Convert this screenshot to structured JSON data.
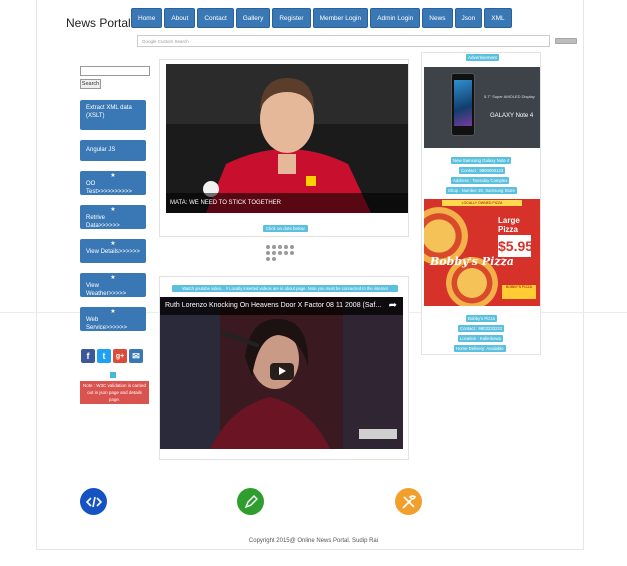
{
  "site": {
    "logo": "News Portal"
  },
  "nav": [
    "Home",
    "About",
    "Contact",
    "Gallery",
    "Register",
    "Member Login",
    "Admin Login",
    "News",
    "Json",
    "XML"
  ],
  "google_search": {
    "placeholder": "Google Custom Search"
  },
  "left": {
    "search_button": "Search",
    "buttons": [
      {
        "label": "Extract XML data (XSLT)",
        "star": false
      },
      {
        "label": "Angular JS",
        "star": false
      },
      {
        "label": "OO Test>>>>>>>>>>",
        "star": true
      },
      {
        "label": "Retrive Data>>>>>>",
        "star": true
      },
      {
        "label": "View Details>>>>>>",
        "star": true
      },
      {
        "label": "View Weather>>>>>",
        "star": true
      },
      {
        "label": "Web Service>>>>>>",
        "star": true
      }
    ],
    "note": "Note : W3C validation is carried out in json page and details page."
  },
  "carousel": {
    "caption": "MATA: WE NEED TO STICK TOGETHER",
    "click_label": "Click on dots below",
    "dot_count": 12
  },
  "video": {
    "label": "Watch youtube video... !! Locally inserted videos are in about page. Note you must be connected to the internet",
    "title": "Ruth Lorenzo Knocking On Heavens Door X Factor 08 11 2008 (Saf..."
  },
  "ads": {
    "advertisement_label": "Advertisement",
    "phone": {
      "text": "5.7\" Super AMOLED Display",
      "brand": "GALAXY Note 4"
    },
    "phone_details": [
      "New Samsung Galaxy Note 4",
      "Contact : 9800000123",
      "Address : Tansalay Complex",
      "Shop : Number 20, Samsung Store"
    ],
    "pizza": {
      "top_banner": "LOCALLY OWNED PIZZA",
      "title": "Large Pizza",
      "price": "$5.95",
      "brand": "Bobby's Pizza",
      "bottom": "BOBBY'S PIZZA"
    },
    "pizza_details": [
      "Bobby's Pizza",
      "Contact : 9803233222",
      "Location : Kalimbowa",
      "Home Delivery: Available"
    ]
  },
  "feature_icons": [
    "code-icon",
    "pen-icon",
    "tools-icon"
  ],
  "footer": "Copyright 2015@ Online News Portal. Sudip Rai"
}
